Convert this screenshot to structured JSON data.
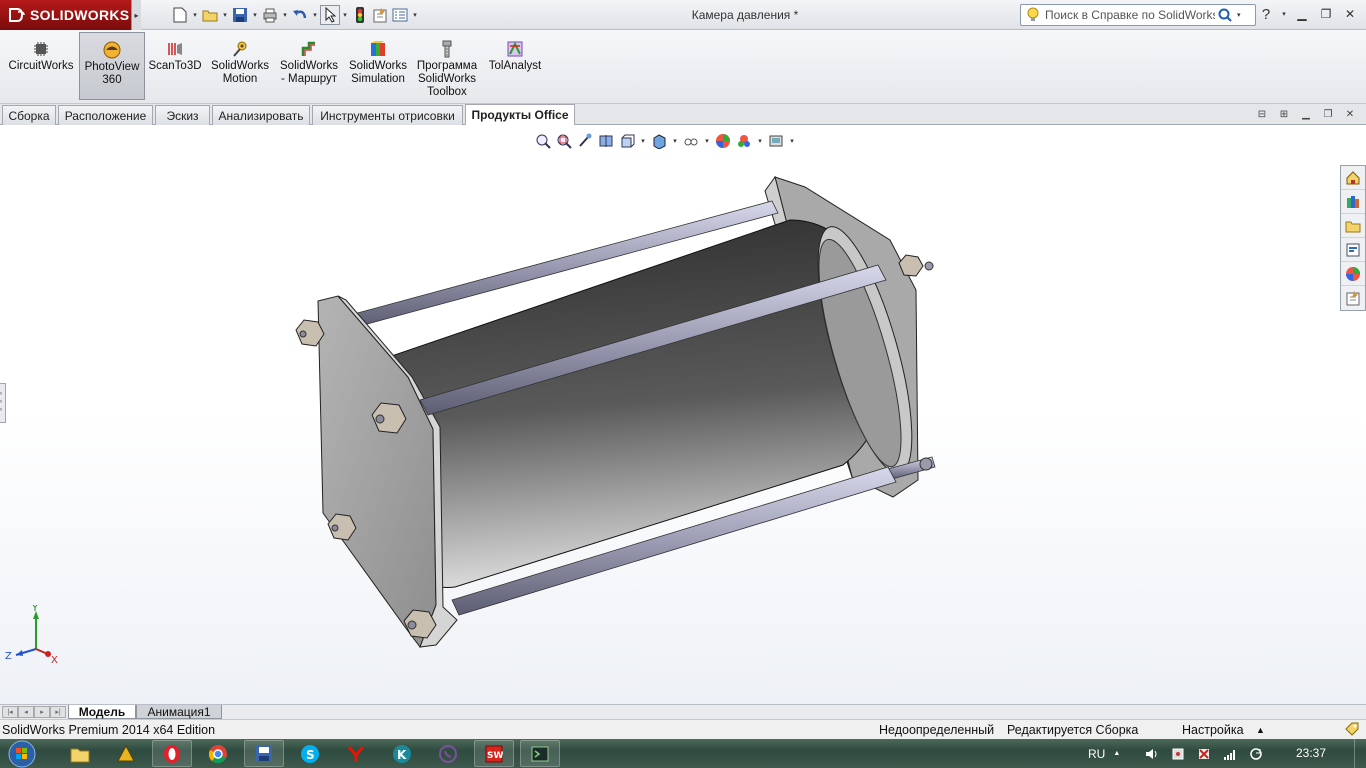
{
  "app": {
    "brand": "SOLIDWORKS",
    "document_title": "Камера давления *",
    "help_search_placeholder": "Поиск в Справке по SolidWorks"
  },
  "quick_access": [
    {
      "icon": "new-document-icon"
    },
    {
      "icon": "open-folder-icon"
    },
    {
      "icon": "save-icon"
    },
    {
      "icon": "print-icon"
    },
    {
      "icon": "undo-icon"
    },
    {
      "icon": "select-pointer-icon"
    },
    {
      "icon": "rebuild-icon"
    },
    {
      "icon": "file-properties-icon"
    },
    {
      "icon": "options-icon"
    }
  ],
  "ribbon": {
    "items": [
      {
        "label": "CircuitWorks",
        "icon": "circuitworks-icon"
      },
      {
        "label": "PhotoView\n360",
        "icon": "photoview-icon",
        "active": true
      },
      {
        "label": "ScanTo3D",
        "icon": "scanto3d-icon"
      },
      {
        "label": "SolidWorks\nMotion",
        "icon": "motion-icon"
      },
      {
        "label": "SolidWorks\n- Маршрут",
        "icon": "routing-icon"
      },
      {
        "label": "SolidWorks\nSimulation",
        "icon": "simulation-icon"
      },
      {
        "label": "Программа\nSolidWorks\nToolbox",
        "icon": "toolbox-icon"
      },
      {
        "label": "TolAnalyst",
        "icon": "tolanalyst-icon"
      }
    ]
  },
  "tabs": [
    {
      "label": "Сборка"
    },
    {
      "label": "Расположение"
    },
    {
      "label": "Эскиз"
    },
    {
      "label": "Анализировать"
    },
    {
      "label": "Инструменты отрисовки"
    },
    {
      "label": "Продукты Office",
      "active": true
    }
  ],
  "triad": {
    "y": "Y",
    "x": "X",
    "z": "Z"
  },
  "model_tabs": [
    {
      "label": "Модель",
      "active": true
    },
    {
      "label": "Анимация1",
      "active": false
    }
  ],
  "status": {
    "edition": "SolidWorks Premium 2014 x64 Edition",
    "definition": "Недоопределенный",
    "editing": "Редактируется Сборка",
    "customize": "Настройка"
  },
  "taskbar": {
    "language": "RU",
    "time": "23:37",
    "apps": [
      "explorer-icon",
      "autocad-icon",
      "opera-icon",
      "chrome-icon",
      "floppy-icon",
      "skype-icon",
      "yandex-icon",
      "kaspersky-icon",
      "viber-icon",
      "solidworks-icon",
      "terminal-icon"
    ]
  },
  "colors": {
    "brand_red": "#9c1212",
    "active_tab_bg": "#ffffff",
    "viewport_bg": "#ffffff"
  }
}
